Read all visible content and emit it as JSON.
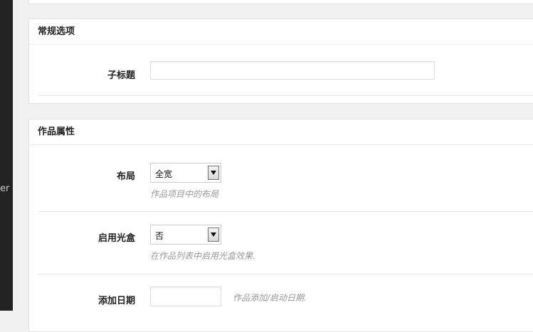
{
  "sidebar": {
    "partial_text": "er"
  },
  "general_options": {
    "title": "常规选项",
    "subtitle_label": "子标题",
    "subtitle_value": ""
  },
  "portfolio_attributes": {
    "title": "作品属性",
    "layout": {
      "label": "布局",
      "selected": "全宽",
      "description": "作品项目中的布局"
    },
    "lightbox": {
      "label": "启用光盒",
      "selected": "否",
      "description": "在作品列表中启用光盒效果."
    },
    "date": {
      "label": "添加日期",
      "value": "",
      "description": "作品添加/启动日期."
    }
  }
}
